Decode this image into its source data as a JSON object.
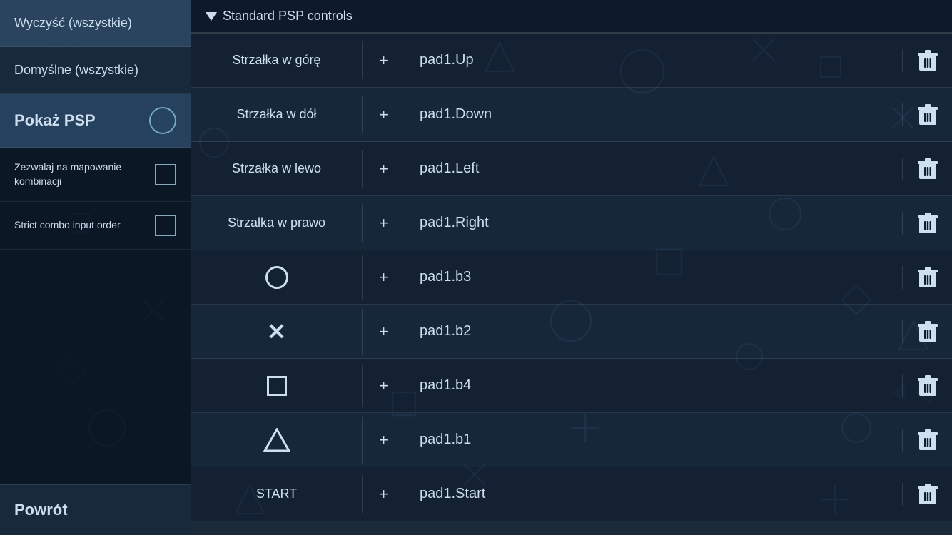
{
  "sidebar": {
    "clear_all_label": "Wyczyść (wszystkie)",
    "defaults_all_label": "Domyślne (wszystkie)",
    "show_psp_label": "Pokaż PSP",
    "allow_combo_label": "Zezwalaj na mapowanie kombinacji",
    "strict_combo_label": "Strict combo input order",
    "back_label": "Powrót"
  },
  "main": {
    "section_title": "Standard PSP controls",
    "mappings": [
      {
        "key": "Strzałka w górę",
        "type": "text",
        "plus": "+",
        "value": "pad1.Up"
      },
      {
        "key": "Strzałka w dół",
        "type": "text",
        "plus": "+",
        "value": "pad1.Down"
      },
      {
        "key": "Strzałka w lewo",
        "type": "text",
        "plus": "+",
        "value": "pad1.Left"
      },
      {
        "key": "Strzałka w prawo",
        "type": "text",
        "plus": "+",
        "value": "pad1.Right"
      },
      {
        "key": "○",
        "type": "symbol_circle",
        "plus": "+",
        "value": "pad1.b3"
      },
      {
        "key": "✕",
        "type": "symbol_cross",
        "plus": "+",
        "value": "pad1.b2"
      },
      {
        "key": "□",
        "type": "symbol_square",
        "plus": "+",
        "value": "pad1.b4"
      },
      {
        "key": "△",
        "type": "symbol_triangle",
        "plus": "+",
        "value": "pad1.b1"
      },
      {
        "key": "START",
        "type": "text",
        "plus": "+",
        "value": "pad1.Start"
      }
    ]
  },
  "colors": {
    "bg_dark": "#0f1c2d",
    "text": "#cce0f0",
    "border": "rgba(255,255,255,0.12)"
  },
  "icons": {
    "trash": "trash-icon",
    "triangle_down": "triangle-down-icon",
    "checkbox": "checkbox-icon"
  }
}
